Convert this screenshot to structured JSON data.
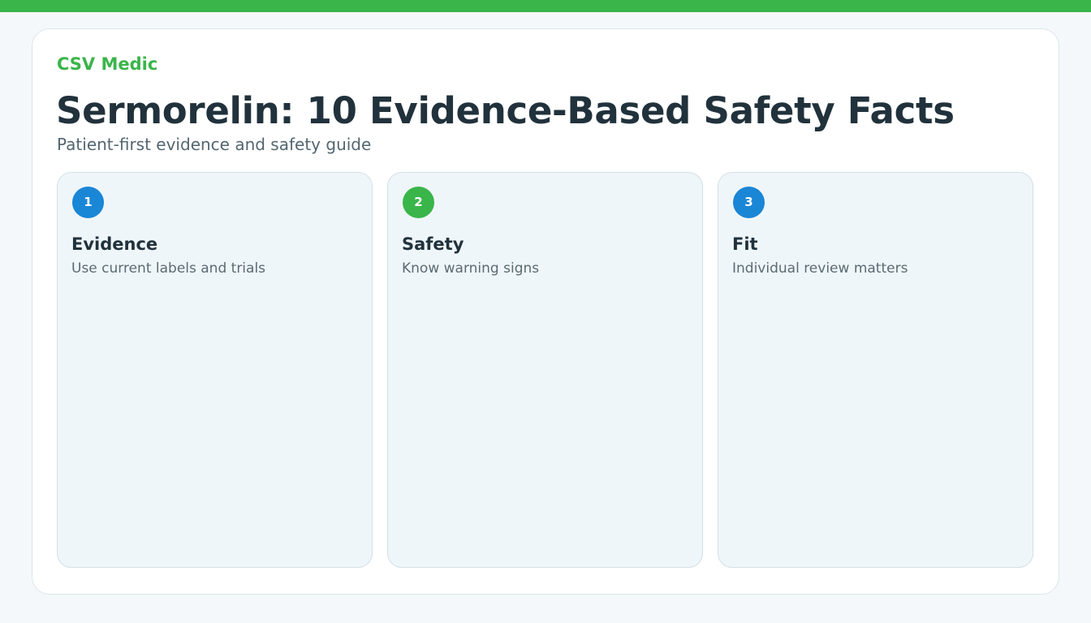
{
  "header": {
    "brand": "CSV Medic",
    "title": "Sermorelin: 10 Evidence-Based Safety Facts",
    "subtitle": "Patient-first evidence and safety guide"
  },
  "cards": [
    {
      "number": "1",
      "title": "Evidence",
      "description": "Use current labels and trials",
      "badge_color": "#1a86d6"
    },
    {
      "number": "2",
      "title": "Safety",
      "description": "Know warning signs",
      "badge_color": "#3ab54a"
    },
    {
      "number": "3",
      "title": "Fit",
      "description": "Individual review matters",
      "badge_color": "#1a86d6"
    }
  ],
  "colors": {
    "accent_green": "#3ab54a",
    "accent_blue": "#1a86d6",
    "text_dark": "#21323c",
    "page_background": "#f4f8fa",
    "card_background": "#eff6f9"
  }
}
